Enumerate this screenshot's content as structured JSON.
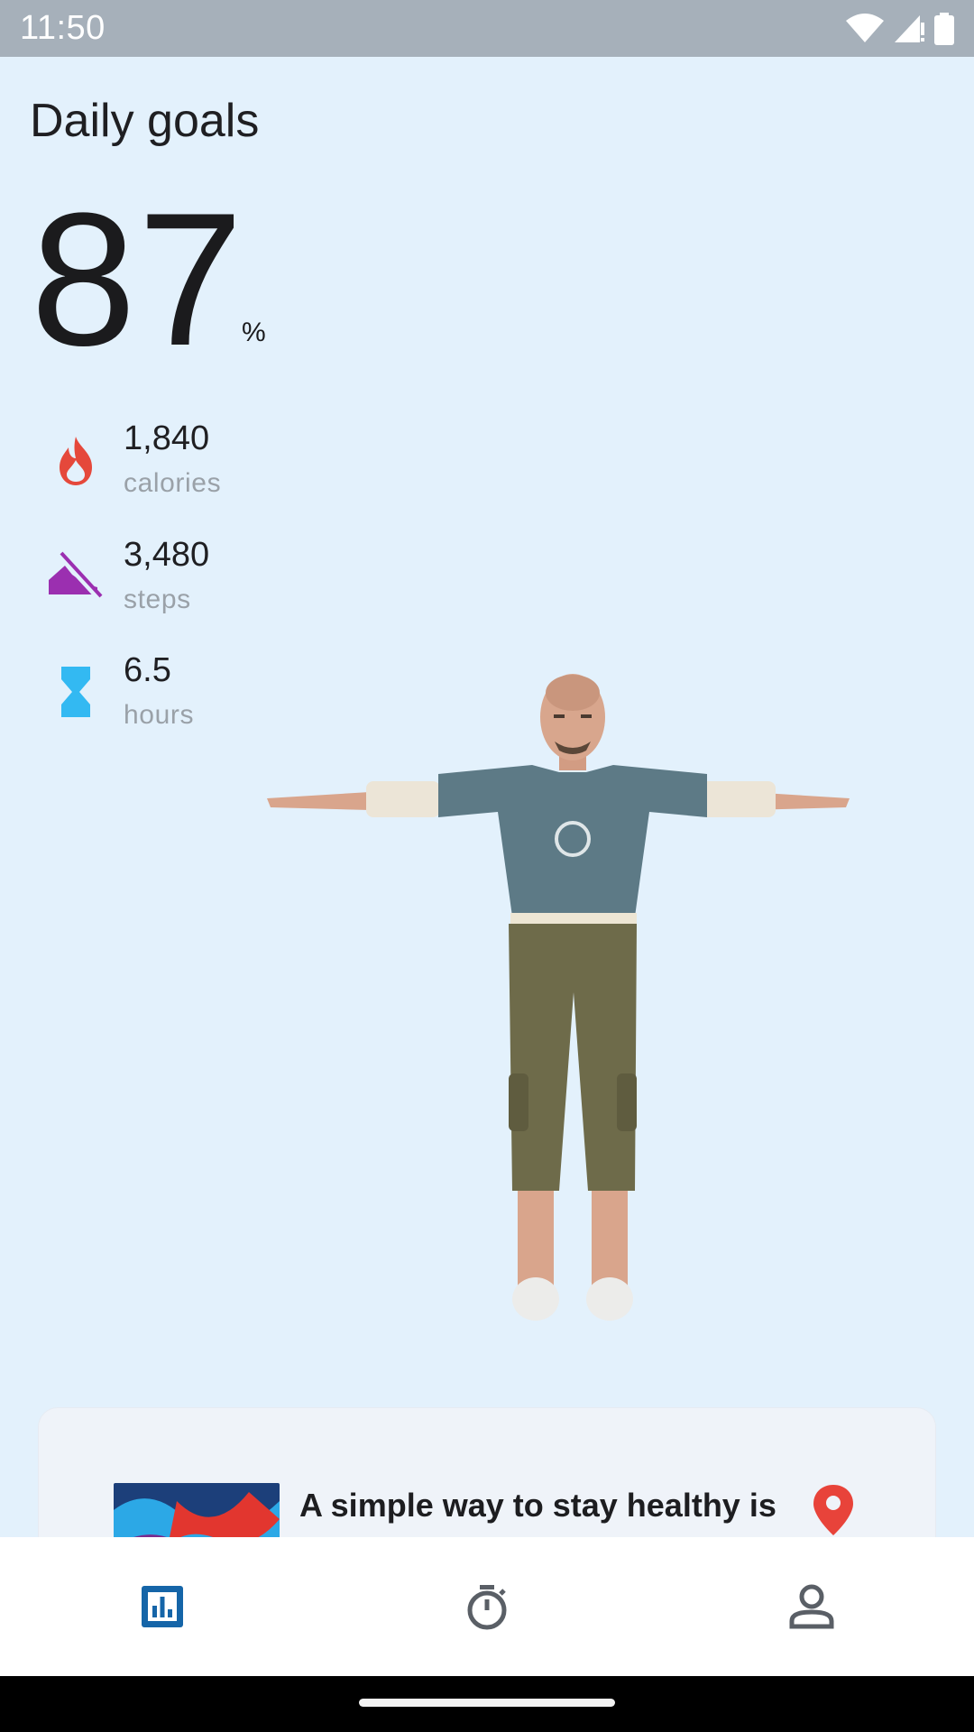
{
  "status_bar": {
    "time": "11:50",
    "icons": [
      "wifi-icon",
      "signal-icon",
      "battery-icon"
    ]
  },
  "header": {
    "title": "Daily goals"
  },
  "goal": {
    "value": "87",
    "unit": "%"
  },
  "stats": [
    {
      "value": "1,840",
      "label": "calories",
      "icon": "flame-icon",
      "color": "#e5483b"
    },
    {
      "value": "3,480",
      "label": "steps",
      "icon": "shoe-off-icon",
      "color": "#9b2fb0"
    },
    {
      "value": "6.5",
      "label": "hours",
      "icon": "hourglass-icon",
      "color": "#33b9f2"
    }
  ],
  "tip_card": {
    "text": "A simple way to stay healthy is",
    "pin_color": "#e8433a"
  },
  "bottom_nav": [
    {
      "icon": "insights-icon",
      "active": true,
      "color": "#1565a8"
    },
    {
      "icon": "timer-icon",
      "active": false,
      "color": "#5a5f66"
    },
    {
      "icon": "profile-icon",
      "active": false,
      "color": "#5a5f66"
    }
  ]
}
